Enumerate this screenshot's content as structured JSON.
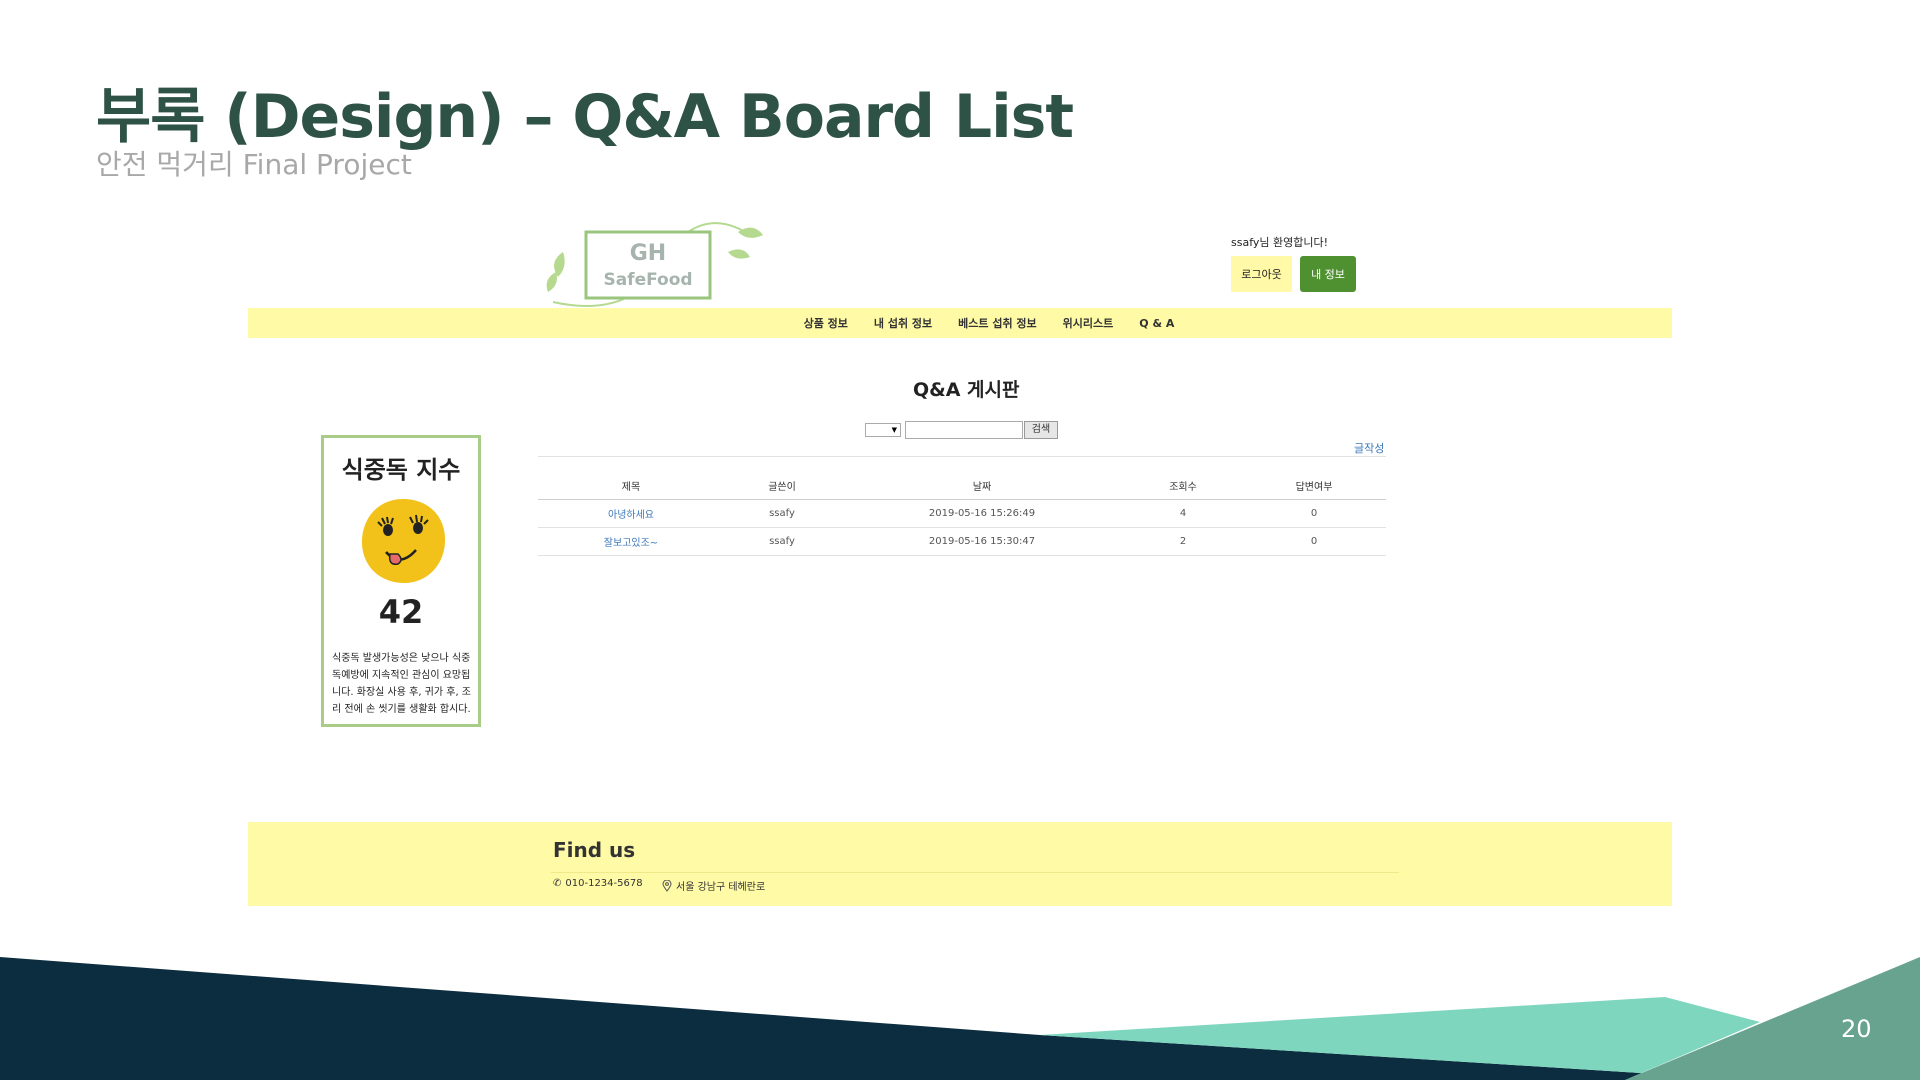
{
  "slide": {
    "title": "부록 (Design) – Q&A Board List",
    "subtitle": "안전 먹거리 Final Project",
    "page_number": "20"
  },
  "logo": {
    "line1": "GH",
    "line2": "SafeFood"
  },
  "header": {
    "welcome": "ssafy님 환영합니다!",
    "logout_label": "로그아웃",
    "mypage_label": "내 정보"
  },
  "nav": {
    "items": [
      "상품 정보",
      "내 섭취 정보",
      "베스트 섭취 정보",
      "위시리스트",
      "Q & A"
    ]
  },
  "board": {
    "title": "Q&A 게시판",
    "search_button": "검색",
    "write_link": "글작성",
    "columns": [
      "제목",
      "글쓴이",
      "날짜",
      "조회수",
      "답변여부"
    ],
    "rows": [
      [
        "아녕하세요",
        "ssafy",
        "2019-05-16 15:26:49",
        "4",
        "0"
      ],
      [
        "잘보고있조~",
        "ssafy",
        "2019-05-16 15:30:47",
        "2",
        "0"
      ]
    ]
  },
  "index_card": {
    "title": "식중독 지수",
    "value": "42",
    "description": "식중독 발생가능성은 낮으나 식중독예방에 지속적인 관심이 요망됩니다. 화장실 사용 후, 귀가 후, 조리 전에 손 씻기를 생활화 합시다."
  },
  "footer": {
    "title": "Find us",
    "phone": "010-1234-5678",
    "address": "서울 강남구 테헤란로"
  },
  "colors": {
    "title": "#2f5246",
    "nav_bg": "#fffaa6",
    "green_button": "#4f9130",
    "link": "#3b78b8",
    "deco_navy": "#0c2d3f",
    "deco_teal": "#7ed6be"
  }
}
